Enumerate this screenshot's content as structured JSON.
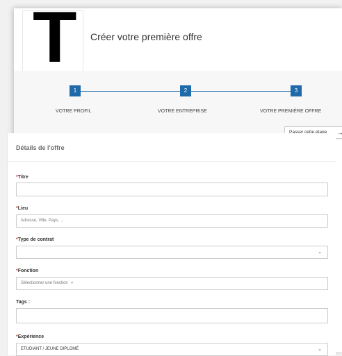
{
  "header": {
    "logo_letter": "T",
    "title": "Créer votre première offre"
  },
  "steps": [
    {
      "number": "1",
      "label": "VOTRE PROFIL"
    },
    {
      "number": "2",
      "label": "VOTRE ENTREPRISE"
    },
    {
      "number": "3",
      "label": "VOTRE PREMIÈRE OFFRE"
    }
  ],
  "skip_button": {
    "label": "Passer cette étape",
    "icon": "arrow-right-icon"
  },
  "form": {
    "section_title": "Détails de l'offre",
    "required_marker": "*",
    "titre": {
      "label": "Titre",
      "value": ""
    },
    "lieu": {
      "label": "Lieu",
      "placeholder": "Adresse, Ville, Pays, ..."
    },
    "type_contrat": {
      "label": "Type de contrat",
      "value": ""
    },
    "fonction": {
      "label": "Fonction",
      "placeholder": "Sélectionner une fonction"
    },
    "tags": {
      "label": "Tags :"
    },
    "experience": {
      "label": "Expérience",
      "value": "ETUDIANT / JEUNE DIPLOMÉ"
    }
  },
  "colors": {
    "accent": "#1f6aa8",
    "required": "#c0392b",
    "background": "#f1f1f1"
  }
}
